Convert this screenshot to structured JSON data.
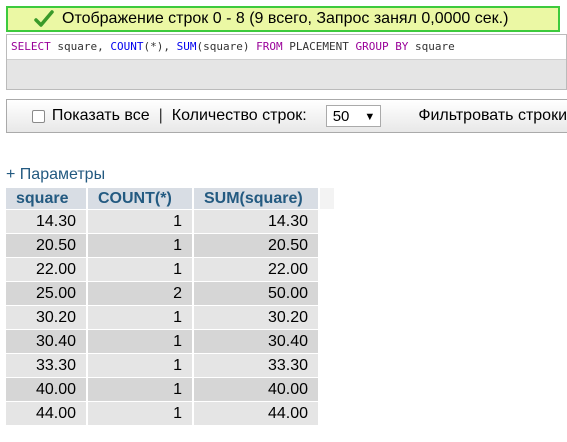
{
  "status": {
    "message": "Отображение строк 0 - 8 (9 всего, Запрос занял 0,0000 сек.)",
    "icon": "check-icon",
    "color": "#3dca3d"
  },
  "sql": {
    "select": "SELECT",
    "t1": " square, ",
    "count": "COUNT",
    "t2": "(*), ",
    "sum": "SUM",
    "t3": "(square) ",
    "from": "FROM",
    "t4": " PLACEMENT ",
    "groupby": "GROUP BY",
    "t5": " square"
  },
  "controls": {
    "show_all": "Показать все",
    "divider": "|",
    "row_count_label": "Количество строк:",
    "row_count_value": "50",
    "filter_label": "Фильтровать строки"
  },
  "params_link": "+ Параметры",
  "table": {
    "headers": [
      "square",
      "COUNT(*)",
      "SUM(square)"
    ],
    "rows": [
      [
        "14.30",
        "1",
        "14.30"
      ],
      [
        "20.50",
        "1",
        "20.50"
      ],
      [
        "22.00",
        "1",
        "22.00"
      ],
      [
        "25.00",
        "2",
        "50.00"
      ],
      [
        "30.20",
        "1",
        "30.20"
      ],
      [
        "30.40",
        "1",
        "30.40"
      ],
      [
        "33.30",
        "1",
        "33.30"
      ],
      [
        "40.00",
        "1",
        "40.00"
      ],
      [
        "44.00",
        "1",
        "44.00"
      ]
    ]
  }
}
